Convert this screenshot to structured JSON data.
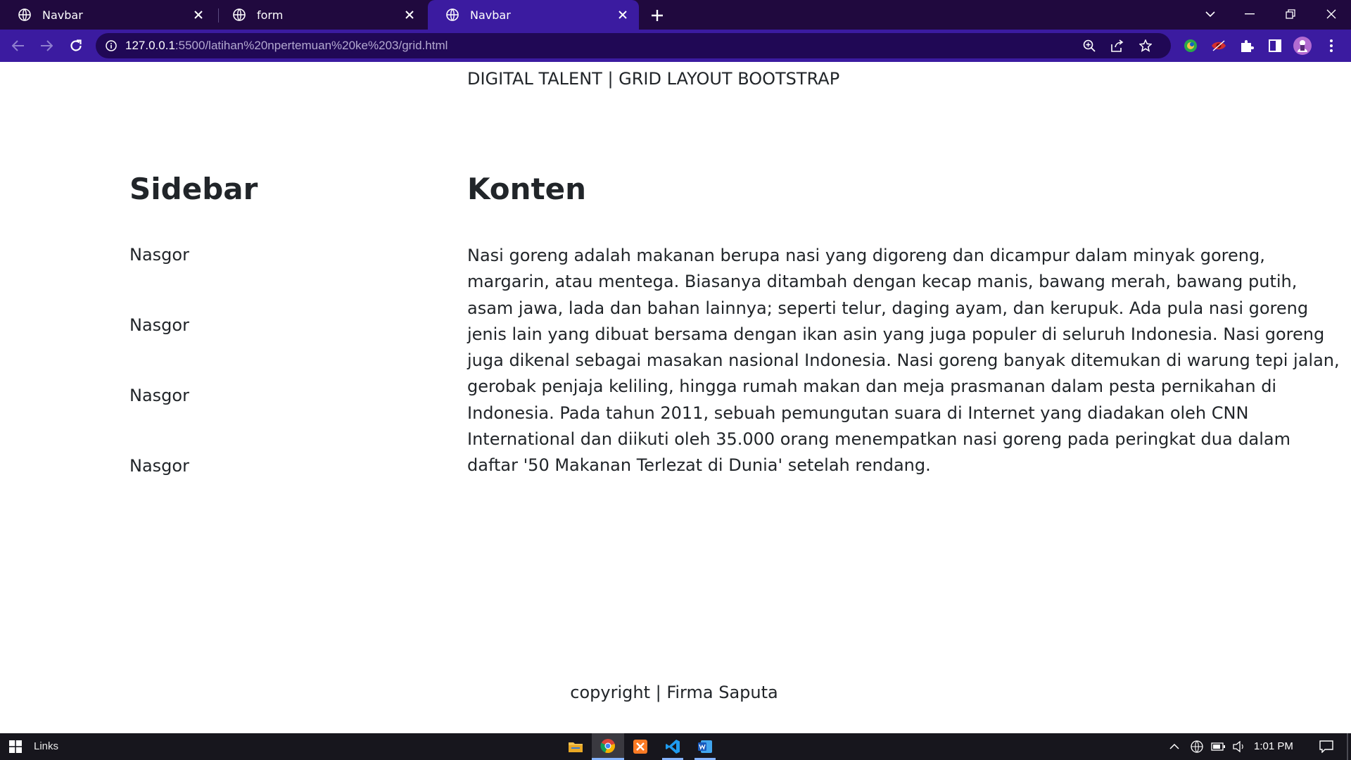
{
  "browser": {
    "tabs": [
      {
        "title": "Navbar",
        "active": false
      },
      {
        "title": "form",
        "active": false
      },
      {
        "title": "Navbar",
        "active": true
      }
    ],
    "url_host": "127.0.0.1",
    "url_path": ":5500/latihan%20npertemuan%20ke%203/grid.html",
    "accent": "#3b1ba0",
    "tabstrip_color": "#20093e"
  },
  "page": {
    "brand": "DIGITAL TALENT | GRID LAYOUT BOOTSTRAP",
    "sidebar_heading": "Sidebar",
    "sidebar_items": [
      "Nasgor",
      "Nasgor",
      "Nasgor",
      "Nasgor"
    ],
    "content_heading": "Konten",
    "content_text": "Nasi goreng adalah makanan berupa nasi yang digoreng dan dicampur dalam minyak goreng, margarin, atau mentega. Biasanya ditambah dengan kecap manis, bawang merah, bawang putih, asam jawa, lada dan bahan lainnya; seperti telur, daging ayam, dan kerupuk. Ada pula nasi goreng jenis lain yang dibuat bersama dengan ikan asin yang juga populer di seluruh Indonesia. Nasi goreng juga dikenal sebagai masakan nasional Indonesia. Nasi goreng banyak ditemukan di warung tepi jalan, gerobak penjaja keliling, hingga rumah makan dan meja prasmanan dalam pesta pernikahan di Indonesia. Pada tahun 2011, sebuah pemungutan suara di Internet yang diadakan oleh CNN International dan diikuti oleh 35.000 orang menempatkan nasi goreng pada peringkat dua dalam daftar '50 Makanan Terlezat di Dunia' setelah rendang.",
    "footer": "copyright | Firma Saputa"
  },
  "taskbar": {
    "links_label": "Links",
    "clock": "1:01 PM",
    "apps": [
      "file-explorer",
      "chrome",
      "xampp",
      "vscode",
      "word"
    ]
  }
}
